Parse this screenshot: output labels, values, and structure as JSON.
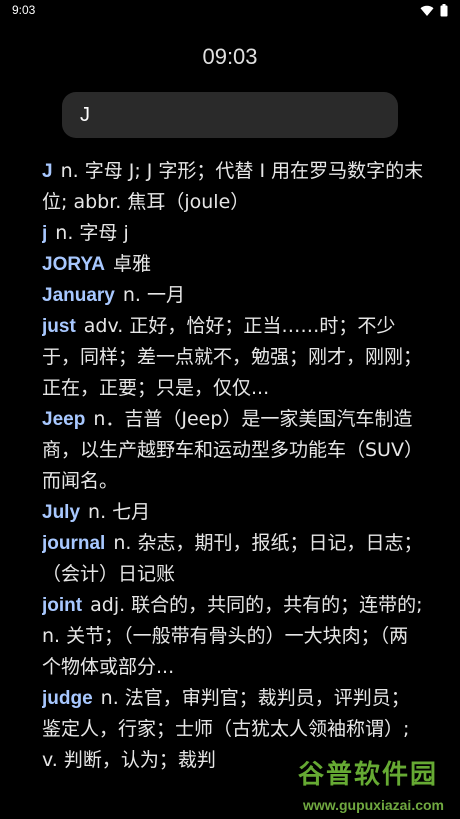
{
  "status_bar": {
    "time": "9:03",
    "icons": [
      "wifi-icon",
      "battery-icon"
    ]
  },
  "clock": "09:03",
  "search": {
    "value": "J",
    "placeholder": ""
  },
  "entries": [
    {
      "word": "J",
      "definition": "n. 字母 J; J 字形；代替 I 用在罗马数字的末位; abbr. 焦耳（joule）"
    },
    {
      "word": "j",
      "definition": "n. 字母 j"
    },
    {
      "word": "JORYA",
      "definition": "卓雅"
    },
    {
      "word": "January",
      "definition": "n. 一月"
    },
    {
      "word": "just",
      "definition": "adv. 正好，恰好；正当……时；不少于，同样；差一点就不，勉强；刚才，刚刚；正在，正要；只是，仅仅..."
    },
    {
      "word": "Jeep",
      "definition": "n．吉普（Jeep）是一家美国汽车制造商，以生产越野车和运动型多功能车（SUV）而闻名。"
    },
    {
      "word": "July",
      "definition": "n. 七月"
    },
    {
      "word": "journal",
      "definition": "n. 杂志，期刊，报纸；日记，日志；（会计）日记账"
    },
    {
      "word": "joint",
      "definition": "adj. 联合的，共同的，共有的；连带的; n. 关节；（一般带有骨头的）一大块肉；（两个物体或部分..."
    },
    {
      "word": "judge",
      "definition": "n. 法官，审判官；裁判员，评判员；鉴定人，行家；士师（古犹太人领袖称谓）; v. 判断，认为；裁判"
    }
  ],
  "watermark": {
    "text": "谷普软件园",
    "url": "www.gupuxiazai.com"
  },
  "colors": {
    "background": "#000000",
    "word": "#a8c8ff",
    "definition": "#e6e6e6",
    "search_bg": "#2a2a2a"
  }
}
